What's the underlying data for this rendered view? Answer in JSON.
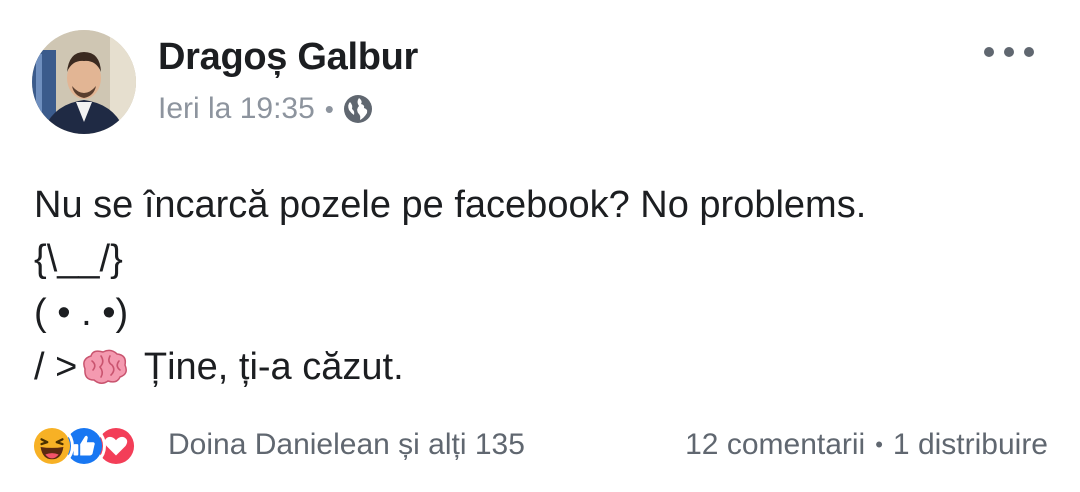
{
  "post": {
    "author": "Dragoș Galbur",
    "timestamp": "Ieri la 19:35",
    "separator": "•",
    "privacy_icon": "globe-icon",
    "more_icon": "more-options-icon",
    "lines": [
      "Nu se încarcă pozele pe facebook? No problems.",
      "{\\__/}",
      "( • . •)"
    ],
    "last_line_prefix": "/ >",
    "last_line_emoji": "brain-emoji",
    "last_line_suffix": " Ține, ți-a căzut."
  },
  "footer": {
    "reaction_icons": [
      "haha-icon",
      "like-icon",
      "love-icon"
    ],
    "reactors": "Doina Danielean și alți 135",
    "comments": "12 comentarii",
    "stats_separator": "•",
    "shares": "1 distribuire"
  },
  "colors": {
    "text_primary": "#1c1e21",
    "text_secondary": "#606770",
    "meta_grey": "#8d949e",
    "like_blue": "#1877f2",
    "love_red": "#f33e58",
    "haha_yellow": "#f7b125"
  }
}
